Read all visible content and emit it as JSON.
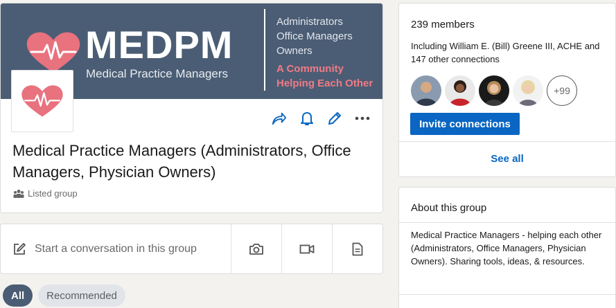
{
  "group": {
    "banner_title": "MEDPM",
    "banner_subtitle": "Medical Practice Managers",
    "banner_roles": [
      "Administrators",
      "Office Managers",
      "Owners"
    ],
    "banner_tagline": [
      "A Community",
      "Helping Each Other"
    ],
    "name": "Medical Practice Managers (Administrators, Office Managers, Physician Owners)",
    "type_label": "Listed group"
  },
  "conversation": {
    "start_label": "Start a conversation in this group"
  },
  "filters": {
    "all_label": "All",
    "recommended_label": "Recommended"
  },
  "members": {
    "count_label": "239 members",
    "including_label": "Including William E. (Bill) Greene III, ACHE and 147 other connections",
    "more_label": "+99",
    "invite_label": "Invite connections",
    "see_all_label": "See all"
  },
  "about": {
    "title": "About this group",
    "description": "Medical Practice Managers - helping each other (Administrators, Office Managers, Physician Owners). Sharing tools, ideas, & resources."
  },
  "colors": {
    "banner_bg": "#4b5d74",
    "heart": "#e8727e",
    "tagline": "#f07b86",
    "primary": "#0a66c2",
    "action_icon": "#0a66c2"
  },
  "icons": {
    "share": "share-icon",
    "bell": "bell-icon",
    "edit": "pencil-icon",
    "more": "more-icon",
    "compose": "compose-icon",
    "camera": "camera-icon",
    "video": "video-icon",
    "document": "document-icon",
    "group_type": "people-icon"
  }
}
